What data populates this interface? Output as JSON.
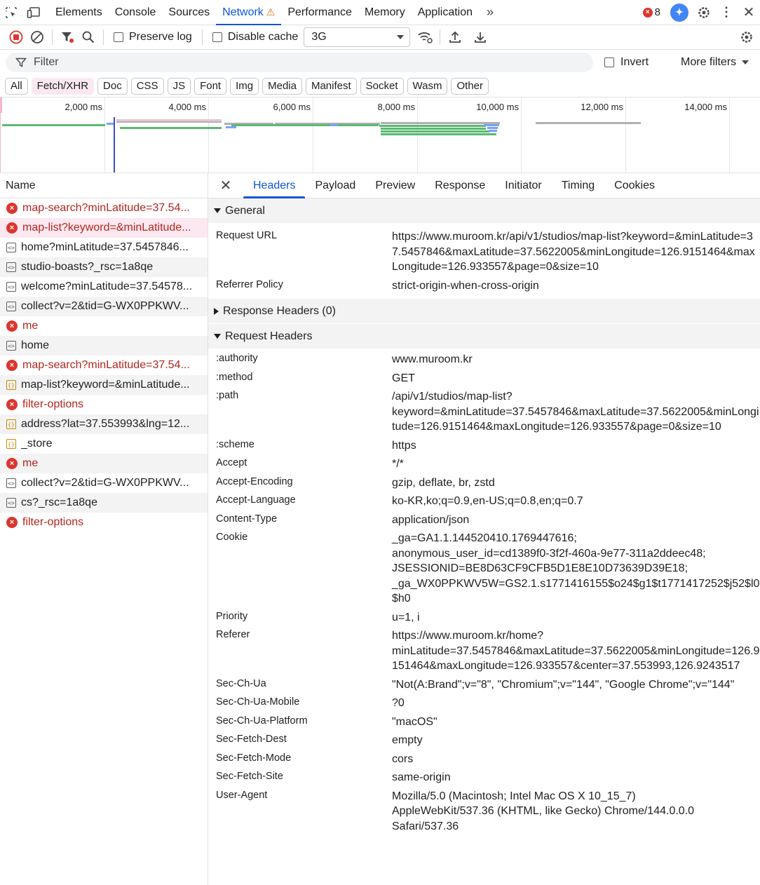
{
  "topbar": {
    "tabs": [
      "Elements",
      "Console",
      "Sources",
      "Network",
      "Performance",
      "Memory",
      "Application"
    ],
    "active_tab": "Network",
    "error_count": "8"
  },
  "toolbar": {
    "preserve_log": "Preserve log",
    "disable_cache": "Disable cache",
    "throttling": "3G"
  },
  "filter": {
    "placeholder": "Filter",
    "invert": "Invert",
    "more_filters": "More filters"
  },
  "type_filters": [
    "All",
    "Fetch/XHR",
    "Doc",
    "CSS",
    "JS",
    "Font",
    "Img",
    "Media",
    "Manifest",
    "Socket",
    "Wasm",
    "Other"
  ],
  "type_filter_selected": "Fetch/XHR",
  "overview": {
    "ticks": [
      "2,000 ms",
      "4,000 ms",
      "6,000 ms",
      "8,000 ms",
      "10,000 ms",
      "12,000 ms",
      "14,000 ms"
    ],
    "colors": {
      "green": "#5bb974",
      "blue": "#7aa2f7",
      "gray": "#b0b0b0",
      "marker": "#3c4fbf"
    }
  },
  "requests": {
    "column_name": "Name",
    "rows": [
      {
        "name": "map-search?minLatitude=37.54...",
        "kind": "error"
      },
      {
        "name": "map-list?keyword=&minLatitude...",
        "kind": "error"
      },
      {
        "name": "home?minLatitude=37.5457846...",
        "kind": "doc"
      },
      {
        "name": "studio-boasts?_rsc=1a8qe",
        "kind": "doc"
      },
      {
        "name": "welcome?minLatitude=37.54578...",
        "kind": "doc"
      },
      {
        "name": "collect?v=2&tid=G-WX0PPKWV...",
        "kind": "doc"
      },
      {
        "name": "me",
        "kind": "error"
      },
      {
        "name": "home",
        "kind": "doc"
      },
      {
        "name": "map-search?minLatitude=37.54...",
        "kind": "error"
      },
      {
        "name": "map-list?keyword=&minLatitude...",
        "kind": "json"
      },
      {
        "name": "filter-options",
        "kind": "error"
      },
      {
        "name": "address?lat=37.553993&lng=12...",
        "kind": "json"
      },
      {
        "name": "_store",
        "kind": "json"
      },
      {
        "name": "me",
        "kind": "error"
      },
      {
        "name": "collect?v=2&tid=G-WX0PPKWV...",
        "kind": "doc"
      },
      {
        "name": "cs?_rsc=1a8qe",
        "kind": "doc"
      },
      {
        "name": "filter-options",
        "kind": "error"
      }
    ]
  },
  "details": {
    "tabs": [
      "Headers",
      "Payload",
      "Preview",
      "Response",
      "Initiator",
      "Timing",
      "Cookies"
    ],
    "active_tab": "Headers",
    "general": {
      "title": "General",
      "rows": [
        {
          "k": "Request URL",
          "v": "https://www.muroom.kr/api/v1/studios/map-list?keyword=&minLatitude=37.5457846&maxLatitude=37.5622005&minLongitude=126.9151464&maxLongitude=126.933557&page=0&size=10"
        },
        {
          "k": "Referrer Policy",
          "v": "strict-origin-when-cross-origin"
        }
      ]
    },
    "response_headers": {
      "title": "Response Headers (0)"
    },
    "request_headers": {
      "title": "Request Headers",
      "rows": [
        {
          "k": ":authority",
          "v": "www.muroom.kr"
        },
        {
          "k": ":method",
          "v": "GET"
        },
        {
          "k": ":path",
          "v": "/api/v1/studios/map-list?\nkeyword=&minLatitude=37.5457846&maxLatitude=37.5622005&minLongitude=126.9151464&maxLongitude=126.933557&page=0&size=10"
        },
        {
          "k": ":scheme",
          "v": "https"
        },
        {
          "k": "Accept",
          "v": "*/*"
        },
        {
          "k": "Accept-Encoding",
          "v": "gzip, deflate, br, zstd"
        },
        {
          "k": "Accept-Language",
          "v": "ko-KR,ko;q=0.9,en-US;q=0.8,en;q=0.7"
        },
        {
          "k": "Content-Type",
          "v": "application/json"
        },
        {
          "k": "Cookie",
          "v": "_ga=GA1.1.144520410.1769447616;\nanonymous_user_id=cd1389f0-3f2f-460a-9e77-311a2ddeec48;\nJSESSIONID=BE8D63CF9CFB5D1E8E10D73639D39E18;\n_ga_WX0PPKWV5W=GS2.1.s1771416155$o24$g1$t1771417252$j52$l0$h0"
        },
        {
          "k": "Priority",
          "v": "u=1, i"
        },
        {
          "k": "Referer",
          "v": "https://www.muroom.kr/home?\nminLatitude=37.5457846&maxLatitude=37.5622005&minLongitude=126.9151464&maxLongitude=126.933557&center=37.553993,126.9243517"
        },
        {
          "k": "Sec-Ch-Ua",
          "v": "\"Not(A:Brand\";v=\"8\", \"Chromium\";v=\"144\", \"Google Chrome\";v=\"144\""
        },
        {
          "k": "Sec-Ch-Ua-Mobile",
          "v": "?0"
        },
        {
          "k": "Sec-Ch-Ua-Platform",
          "v": "\"macOS\""
        },
        {
          "k": "Sec-Fetch-Dest",
          "v": "empty"
        },
        {
          "k": "Sec-Fetch-Mode",
          "v": "cors"
        },
        {
          "k": "Sec-Fetch-Site",
          "v": "same-origin"
        },
        {
          "k": "User-Agent",
          "v": "Mozilla/5.0 (Macintosh; Intel Mac OS X 10_15_7)\nAppleWebKit/537.36 (KHTML, like Gecko) Chrome/144.0.0.0\nSafari/537.36"
        }
      ]
    }
  }
}
